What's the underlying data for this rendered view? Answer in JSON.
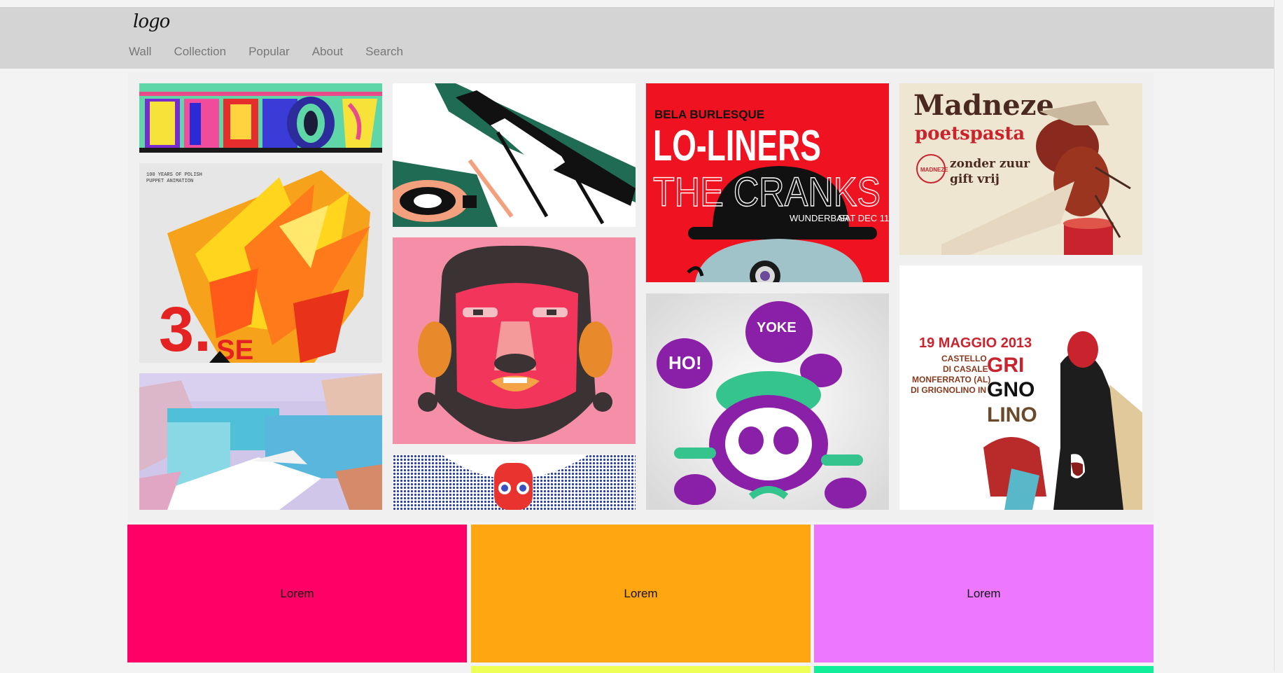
{
  "brand": {
    "logo_text": "logo"
  },
  "nav": {
    "items": [
      {
        "label": "Wall"
      },
      {
        "label": "Collection"
      },
      {
        "label": "Popular"
      },
      {
        "label": "About"
      },
      {
        "label": "Search"
      }
    ]
  },
  "posters": {
    "lo_liners": {
      "kicker": "BELA BURLESQUE",
      "title": "LO-LINERS",
      "subtitle": "THE CRANKS",
      "venue": "WUNDERBAR",
      "date": "SAT DEC 11"
    },
    "madneze": {
      "title": "Madneze",
      "subtitle": "poetspasta",
      "tag1": "zonder zuur",
      "tag2": "gift vrij",
      "seal": "MADNEZE"
    },
    "polish": {
      "caption1": "100 YEARS OF POLISH",
      "caption2": "PUPPET ANIMATION",
      "number": "3.",
      "letters": "SE"
    },
    "grignolino": {
      "date": "19 MAGGIO 2013",
      "place1": "CASTELLO",
      "place2": "DI CASALE",
      "place3": "MONFERRATO (AL)",
      "place4": "DI GRIGNOLINO IN",
      "word1": "GRI",
      "word2": "GNO",
      "word3": "LINO"
    },
    "hoi": {
      "bubble1": "HO!",
      "bubble2": "YOKE"
    }
  },
  "banners": [
    {
      "label": "Lorem",
      "color": "#ff0066"
    },
    {
      "label": "Lorem",
      "color": "#ffa611"
    },
    {
      "label": "Lorem",
      "color": "#ee77ff"
    }
  ],
  "banner_row2_colors": [
    "#f3f3f3",
    "#eeff55",
    "#11ee99"
  ]
}
